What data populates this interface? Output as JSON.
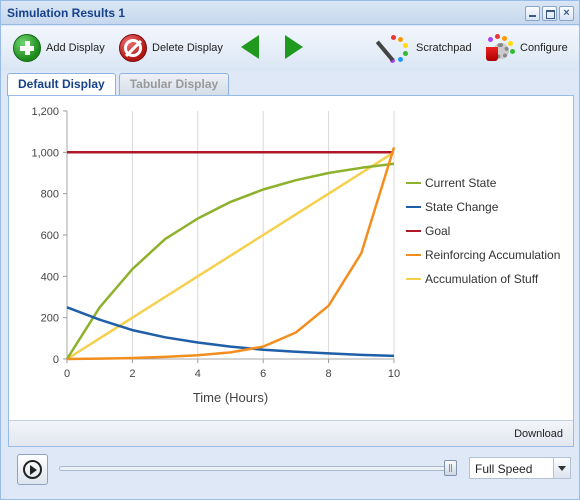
{
  "window": {
    "title": "Simulation Results 1",
    "buttons": [
      "minimize-icon",
      "maximize-icon",
      "close-icon"
    ]
  },
  "toolbar": {
    "add_display": "Add Display",
    "delete_display": "Delete Display",
    "scratchpad": "Scratchpad",
    "configure": "Configure"
  },
  "tabs": [
    {
      "label": "Default Display",
      "active": true
    },
    {
      "label": "Tabular Display",
      "active": false
    }
  ],
  "panel": {
    "download": "Download"
  },
  "playback": {
    "speed": "Full Speed",
    "position": 1.0
  },
  "chart_data": {
    "type": "line",
    "xlabel": "Time (Hours)",
    "ylabel": "",
    "xlim": [
      0,
      10
    ],
    "ylim": [
      0,
      1200
    ],
    "xticks": [
      0,
      2,
      4,
      6,
      8,
      10
    ],
    "yticks": [
      0,
      200,
      400,
      600,
      800,
      1000,
      1200
    ],
    "ytick_labels": [
      "0",
      "200",
      "400",
      "600",
      "800",
      "1,000",
      "1,200"
    ],
    "grid": "vertical",
    "legend": "right",
    "x": [
      0,
      1,
      2,
      3,
      4,
      5,
      6,
      7,
      8,
      9,
      10
    ],
    "series": [
      {
        "name": "Current State",
        "color": "#8db12a",
        "values": [
          0,
          250,
          435,
          580,
          680,
          760,
          820,
          865,
          900,
          925,
          945
        ]
      },
      {
        "name": "State Change",
        "color": "#1f5fa8",
        "values": [
          250,
          190,
          140,
          105,
          80,
          60,
          45,
          35,
          27,
          20,
          15
        ]
      },
      {
        "name": "Goal",
        "color": "#b0182a",
        "values": [
          1000,
          1000,
          1000,
          1000,
          1000,
          1000,
          1000,
          1000,
          1000,
          1000,
          1000
        ]
      },
      {
        "name": "Reinforcing Accumulation",
        "color": "#f38e1e",
        "values": [
          0,
          2,
          5,
          10,
          18,
          32,
          60,
          128,
          258,
          512,
          1024
        ]
      },
      {
        "name": "Accumulation of Stuff",
        "color": "#f6d04d",
        "values": [
          0,
          100,
          200,
          300,
          400,
          500,
          600,
          700,
          800,
          900,
          1000
        ]
      }
    ]
  }
}
